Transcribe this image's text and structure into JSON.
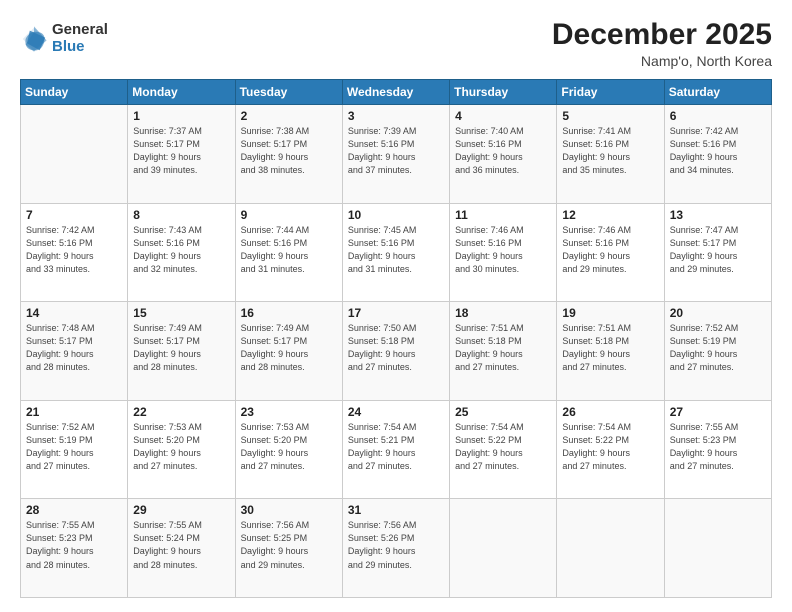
{
  "logo": {
    "general": "General",
    "blue": "Blue"
  },
  "header": {
    "title": "December 2025",
    "subtitle": "Namp'o, North Korea"
  },
  "days_of_week": [
    "Sunday",
    "Monday",
    "Tuesday",
    "Wednesday",
    "Thursday",
    "Friday",
    "Saturday"
  ],
  "weeks": [
    [
      {
        "day": "",
        "info": ""
      },
      {
        "day": "1",
        "info": "Sunrise: 7:37 AM\nSunset: 5:17 PM\nDaylight: 9 hours\nand 39 minutes."
      },
      {
        "day": "2",
        "info": "Sunrise: 7:38 AM\nSunset: 5:17 PM\nDaylight: 9 hours\nand 38 minutes."
      },
      {
        "day": "3",
        "info": "Sunrise: 7:39 AM\nSunset: 5:16 PM\nDaylight: 9 hours\nand 37 minutes."
      },
      {
        "day": "4",
        "info": "Sunrise: 7:40 AM\nSunset: 5:16 PM\nDaylight: 9 hours\nand 36 minutes."
      },
      {
        "day": "5",
        "info": "Sunrise: 7:41 AM\nSunset: 5:16 PM\nDaylight: 9 hours\nand 35 minutes."
      },
      {
        "day": "6",
        "info": "Sunrise: 7:42 AM\nSunset: 5:16 PM\nDaylight: 9 hours\nand 34 minutes."
      }
    ],
    [
      {
        "day": "7",
        "info": "Sunrise: 7:42 AM\nSunset: 5:16 PM\nDaylight: 9 hours\nand 33 minutes."
      },
      {
        "day": "8",
        "info": "Sunrise: 7:43 AM\nSunset: 5:16 PM\nDaylight: 9 hours\nand 32 minutes."
      },
      {
        "day": "9",
        "info": "Sunrise: 7:44 AM\nSunset: 5:16 PM\nDaylight: 9 hours\nand 31 minutes."
      },
      {
        "day": "10",
        "info": "Sunrise: 7:45 AM\nSunset: 5:16 PM\nDaylight: 9 hours\nand 31 minutes."
      },
      {
        "day": "11",
        "info": "Sunrise: 7:46 AM\nSunset: 5:16 PM\nDaylight: 9 hours\nand 30 minutes."
      },
      {
        "day": "12",
        "info": "Sunrise: 7:46 AM\nSunset: 5:16 PM\nDaylight: 9 hours\nand 29 minutes."
      },
      {
        "day": "13",
        "info": "Sunrise: 7:47 AM\nSunset: 5:17 PM\nDaylight: 9 hours\nand 29 minutes."
      }
    ],
    [
      {
        "day": "14",
        "info": "Sunrise: 7:48 AM\nSunset: 5:17 PM\nDaylight: 9 hours\nand 28 minutes."
      },
      {
        "day": "15",
        "info": "Sunrise: 7:49 AM\nSunset: 5:17 PM\nDaylight: 9 hours\nand 28 minutes."
      },
      {
        "day": "16",
        "info": "Sunrise: 7:49 AM\nSunset: 5:17 PM\nDaylight: 9 hours\nand 28 minutes."
      },
      {
        "day": "17",
        "info": "Sunrise: 7:50 AM\nSunset: 5:18 PM\nDaylight: 9 hours\nand 27 minutes."
      },
      {
        "day": "18",
        "info": "Sunrise: 7:51 AM\nSunset: 5:18 PM\nDaylight: 9 hours\nand 27 minutes."
      },
      {
        "day": "19",
        "info": "Sunrise: 7:51 AM\nSunset: 5:18 PM\nDaylight: 9 hours\nand 27 minutes."
      },
      {
        "day": "20",
        "info": "Sunrise: 7:52 AM\nSunset: 5:19 PM\nDaylight: 9 hours\nand 27 minutes."
      }
    ],
    [
      {
        "day": "21",
        "info": "Sunrise: 7:52 AM\nSunset: 5:19 PM\nDaylight: 9 hours\nand 27 minutes."
      },
      {
        "day": "22",
        "info": "Sunrise: 7:53 AM\nSunset: 5:20 PM\nDaylight: 9 hours\nand 27 minutes."
      },
      {
        "day": "23",
        "info": "Sunrise: 7:53 AM\nSunset: 5:20 PM\nDaylight: 9 hours\nand 27 minutes."
      },
      {
        "day": "24",
        "info": "Sunrise: 7:54 AM\nSunset: 5:21 PM\nDaylight: 9 hours\nand 27 minutes."
      },
      {
        "day": "25",
        "info": "Sunrise: 7:54 AM\nSunset: 5:22 PM\nDaylight: 9 hours\nand 27 minutes."
      },
      {
        "day": "26",
        "info": "Sunrise: 7:54 AM\nSunset: 5:22 PM\nDaylight: 9 hours\nand 27 minutes."
      },
      {
        "day": "27",
        "info": "Sunrise: 7:55 AM\nSunset: 5:23 PM\nDaylight: 9 hours\nand 27 minutes."
      }
    ],
    [
      {
        "day": "28",
        "info": "Sunrise: 7:55 AM\nSunset: 5:23 PM\nDaylight: 9 hours\nand 28 minutes."
      },
      {
        "day": "29",
        "info": "Sunrise: 7:55 AM\nSunset: 5:24 PM\nDaylight: 9 hours\nand 28 minutes."
      },
      {
        "day": "30",
        "info": "Sunrise: 7:56 AM\nSunset: 5:25 PM\nDaylight: 9 hours\nand 29 minutes."
      },
      {
        "day": "31",
        "info": "Sunrise: 7:56 AM\nSunset: 5:26 PM\nDaylight: 9 hours\nand 29 minutes."
      },
      {
        "day": "",
        "info": ""
      },
      {
        "day": "",
        "info": ""
      },
      {
        "day": "",
        "info": ""
      }
    ]
  ]
}
